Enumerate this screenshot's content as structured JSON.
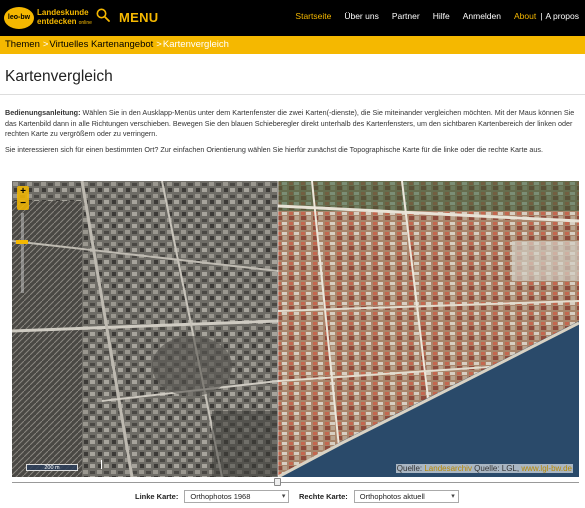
{
  "header": {
    "logo_mark": "leo-bw",
    "logo_line1": "Landeskunde",
    "logo_line2": "entdecken",
    "logo_line2_suffix": "online",
    "menu_label": "MENU",
    "nav": [
      {
        "label": "Startseite"
      },
      {
        "label": "Über uns"
      },
      {
        "label": "Partner"
      },
      {
        "label": "Hilfe"
      },
      {
        "label": "Anmelden"
      },
      {
        "label": "About"
      }
    ],
    "lang_separator": "|",
    "lang_label": "A propos",
    "accent_color": "#f5b800"
  },
  "breadcrumb": [
    {
      "label": "Themen"
    },
    {
      "label": "Virtuelles Kartenangebot"
    },
    {
      "label": "Kartenvergleich"
    }
  ],
  "breadcrumb_separator": ">",
  "page": {
    "title": "Kartenvergleich",
    "instructions_label": "Bedienungsanleitung:",
    "instructions_text": " Wählen Sie in den Ausklapp-Menüs unter dem Kartenfenster die zwei Karten(-dienste), die Sie miteinander vergleichen möchten. Mit der Maus können Sie das Kartenbild dann in alle Richtungen verschieben. Bewegen Sie den blauen Schieberegler direkt unterhalb des Kartenfensters, um den sichtbaren Kartenbereich der linken oder rechten Karte zu vergrößern oder zu verringern.",
    "hint_text": "Sie interessieren sich für einen bestimmten Ort? Zur einfachen Orientierung wählen Sie hierfür zunächst die Topographische Karte für die linke oder die rechte Karte aus."
  },
  "map": {
    "zoom_in": "+",
    "zoom_out": "−",
    "scale_label": "200 m",
    "credits_prefix": "Quelle: ",
    "credits_link1": "Landesarchiv",
    "credits_middle": " Quelle: LGL, ",
    "credits_link2": "www.lgl-bw.de",
    "split_fraction": 0.47
  },
  "selects": {
    "left_label": "Linke Karte:",
    "left_value": "Orthophotos 1968",
    "right_label": "Rechte Karte:",
    "right_value": "Orthophotos aktuell"
  },
  "icons": {
    "menu": "search-icon",
    "dropdown": "chevron-down-icon"
  }
}
